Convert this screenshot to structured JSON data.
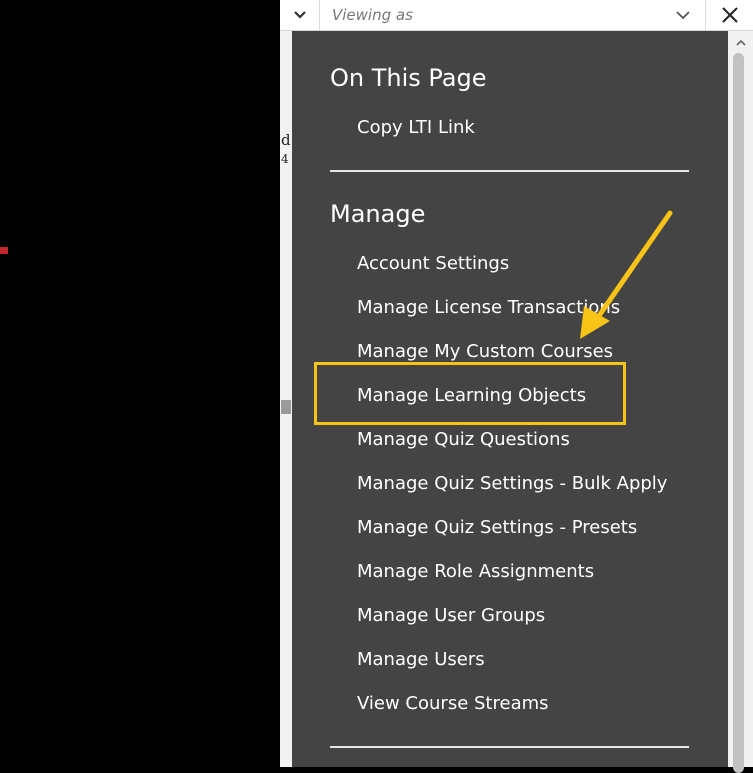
{
  "topbar": {
    "viewing_as_placeholder": "Viewing as"
  },
  "background": {
    "fragment_chars": [
      "d",
      "4"
    ]
  },
  "menu": {
    "sections": [
      {
        "title": "On This Page",
        "items": [
          {
            "label": "Copy LTI Link"
          }
        ]
      },
      {
        "title": "Manage",
        "items": [
          {
            "label": "Account Settings"
          },
          {
            "label": "Manage License Transactions"
          },
          {
            "label": "Manage My Custom Courses"
          },
          {
            "label": "Manage Learning Objects",
            "highlighted": true
          },
          {
            "label": "Manage Quiz Questions"
          },
          {
            "label": "Manage Quiz Settings - Bulk Apply"
          },
          {
            "label": "Manage Quiz Settings - Presets"
          },
          {
            "label": "Manage Role Assignments"
          },
          {
            "label": "Manage User Groups"
          },
          {
            "label": "Manage Users"
          },
          {
            "label": "View Course Streams"
          }
        ]
      }
    ]
  },
  "colors": {
    "panel_bg": "#444444",
    "highlight": "#f6c316",
    "text": "#ffffff"
  },
  "icons": [
    "chevron-down-icon",
    "close-icon",
    "scroll-up-arrow-icon"
  ]
}
